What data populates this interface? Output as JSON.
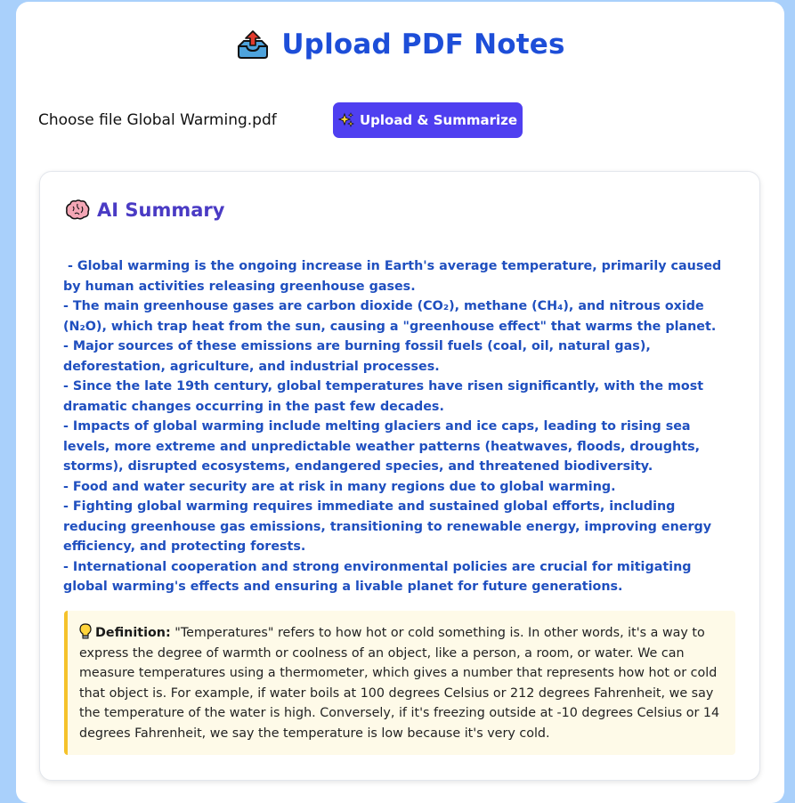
{
  "header": {
    "title": "Upload PDF Notes",
    "icon": "outbox-tray-icon"
  },
  "upload": {
    "file_label": "Choose file Global Warming.pdf",
    "button_label": "Upload & Summarize",
    "button_icon": "sparkles-icon",
    "button_color": "#4f3ff0"
  },
  "summary": {
    "title": "AI Summary",
    "icon": "brain-icon",
    "lines": [
      " - Global warming is the ongoing increase in Earth's average temperature, primarily caused by human activities releasing greenhouse gases.",
      "- The main greenhouse gases are carbon dioxide (CO₂), methane (CH₄), and nitrous oxide (N₂O), which trap heat from the sun, causing a \"greenhouse effect\" that warms the planet.",
      "- Major sources of these emissions are burning fossil fuels (coal, oil, natural gas), deforestation, agriculture, and industrial processes.",
      "- Since the late 19th century, global temperatures have risen significantly, with the most dramatic changes occurring in the past few decades.",
      "- Impacts of global warming include melting glaciers and ice caps, leading to rising sea levels, more extreme and unpredictable weather patterns (heatwaves, floods, droughts, storms), disrupted ecosystems, endangered species, and threatened biodiversity.",
      "- Food and water security are at risk in many regions due to global warming.",
      "- Fighting global warming requires immediate and sustained global efforts, including reducing greenhouse gas emissions, transitioning to renewable energy, improving energy efficiency, and protecting forests.",
      "- International cooperation and strong environmental policies are crucial for mitigating global warming's effects and ensuring a livable planet for future generations."
    ]
  },
  "definition": {
    "icon": "light-bulb-icon",
    "label": "Definition:",
    "text": "\"Temperatures\" refers to how hot or cold something is. In other words, it's a way to express the degree of warmth or coolness of an object, like a person, a room, or water. We can measure temperatures using a thermometer, which gives a number that represents how hot or cold that object is. For example, if water boils at 100 degrees Celsius or 212 degrees Fahrenheit, we say the temperature of the water is high. Conversely, if it's freezing outside at -10 degrees Celsius or 14 degrees Fahrenheit, we say the temperature is low because it's very cold."
  },
  "colors": {
    "background": "#a9d0fb",
    "title": "#1d4ed8",
    "summary_text": "#1f4fbf",
    "summary_title": "#4a3bc4",
    "definition_bg": "#fefae8",
    "definition_border": "#f5c22a"
  }
}
